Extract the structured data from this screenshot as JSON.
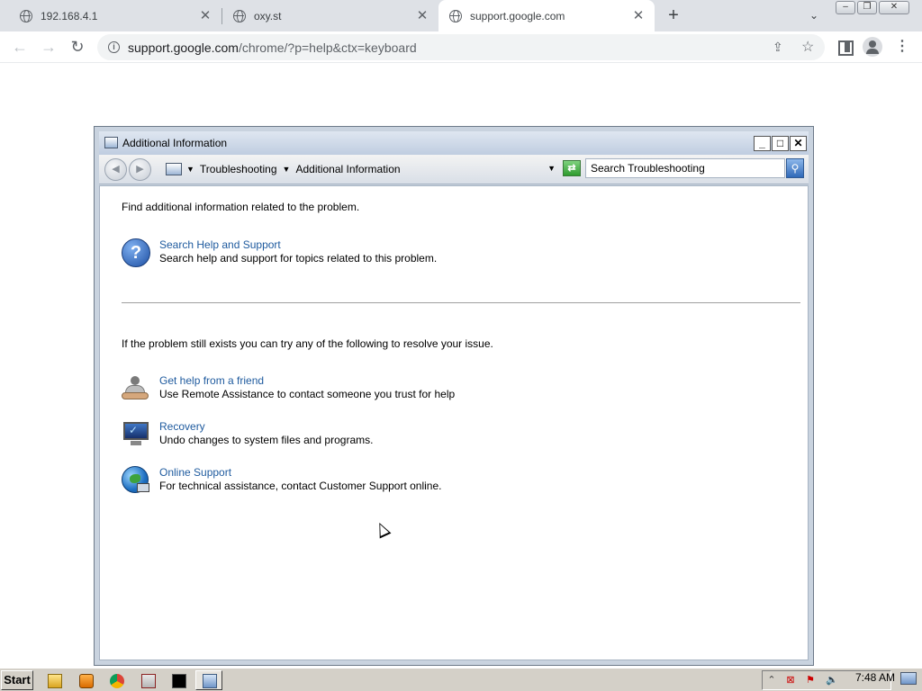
{
  "browser": {
    "tabs": [
      {
        "title": "192.168.4.1"
      },
      {
        "title": "oxy.st"
      },
      {
        "title": "support.google.com"
      }
    ],
    "url_host": "support.google.com",
    "url_rest": "/chrome/?p=help&ctx=keyboard"
  },
  "dialog": {
    "title": "Additional Information",
    "breadcrumb": [
      "Troubleshooting",
      "Additional Information"
    ],
    "search_placeholder": "Search Troubleshooting",
    "intro": "Find additional information related to the problem.",
    "items": [
      {
        "link": "Search Help and Support",
        "desc": "Search help and support for topics related to this problem."
      }
    ],
    "note": "If the problem still exists you can try any of the following to resolve your issue.",
    "more_items": [
      {
        "link": "Get help from a friend",
        "desc": "Use Remote Assistance to contact someone you trust for help"
      },
      {
        "link": "Recovery",
        "desc": "Undo changes to system files and programs."
      },
      {
        "link": "Online Support",
        "desc": "For technical assistance, contact Customer Support online."
      }
    ]
  },
  "taskbar": {
    "start_label": "Start",
    "clock": "7:48 AM"
  }
}
